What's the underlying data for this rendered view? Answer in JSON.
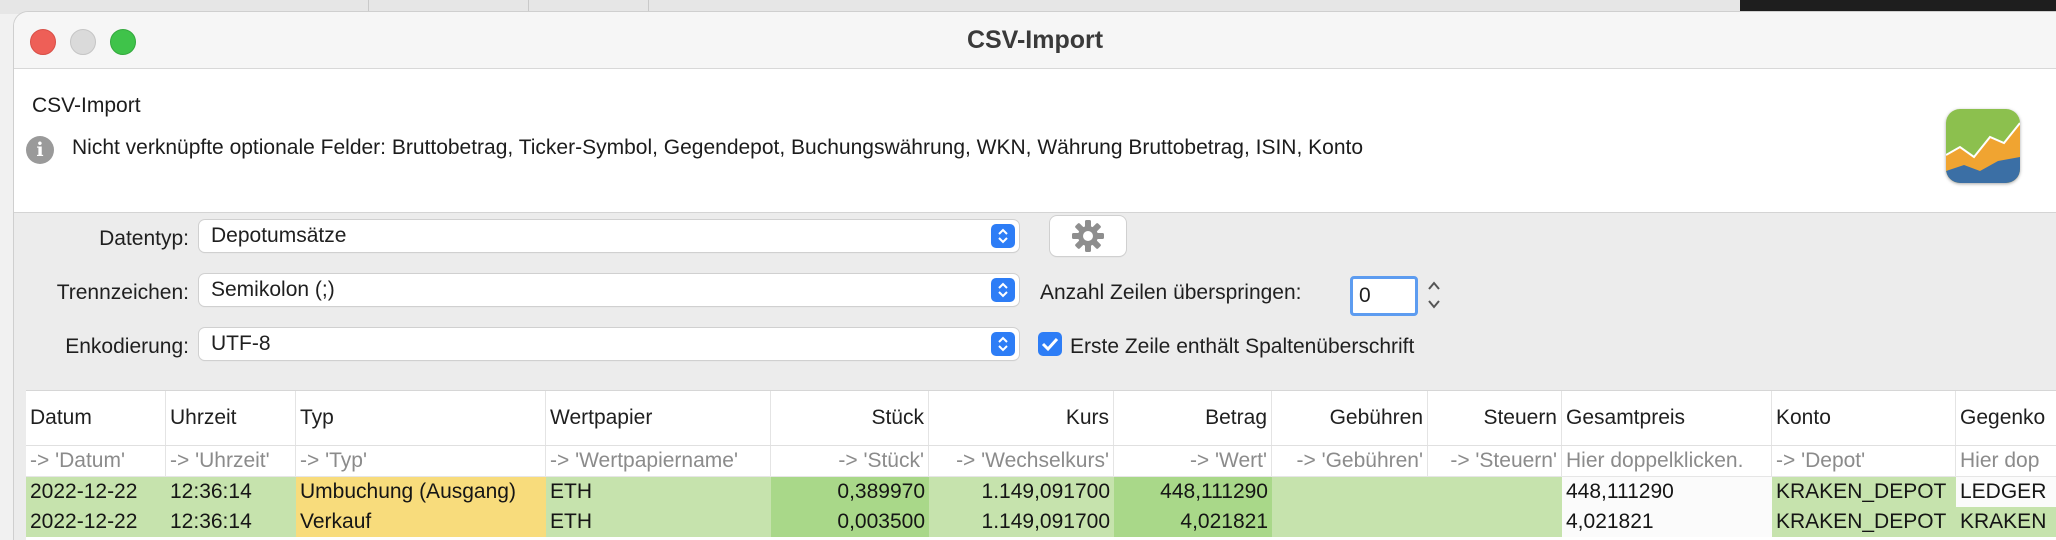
{
  "window": {
    "title": "CSV-Import"
  },
  "header": {
    "title": "CSV-Import",
    "info_text": "Nicht verknüpfte optionale Felder: Bruttobetrag, Ticker-Symbol, Gegendepot, Buchungswährung, WKN, Währung Bruttobetrag, ISIN, Konto"
  },
  "form": {
    "datatype_label": "Datentyp:",
    "datatype_value": "Depotumsätze",
    "separator_label": "Trennzeichen:",
    "separator_value": "Semikolon (;)",
    "encoding_label": "Enkodierung:",
    "encoding_value": "UTF-8",
    "skip_label": "Anzahl Zeilen überspringen:",
    "skip_value": "0",
    "header_checkbox_label": "Erste Zeile enthält Spaltenüberschrift",
    "header_checkbox_checked": true
  },
  "table": {
    "columns": [
      "Datum",
      "Uhrzeit",
      "Typ",
      "Wertpapier",
      "Stück",
      "Kurs",
      "Betrag",
      "Gebühren",
      "Steuern",
      "Gesamtpreis",
      "Konto",
      "Gegenko"
    ],
    "mappings": [
      "-> 'Datum'",
      "-> 'Uhrzeit'",
      "-> 'Typ'",
      "-> 'Wertpapiername'",
      "-> 'Stück'",
      "-> 'Wechselkurs'",
      "-> 'Wert'",
      "-> 'Gebühren'",
      "-> 'Steuern'",
      "Hier doppelklicken.",
      "-> 'Depot'",
      "Hier dop"
    ],
    "rows": [
      [
        "2022-12-22",
        "12:36:14",
        "Umbuchung (Ausgang)",
        "ETH",
        "0,389970",
        "1.149,091700",
        "448,111290",
        "",
        "",
        "448,111290",
        "KRAKEN_DEPOT",
        "LEDGER"
      ],
      [
        "2022-12-22",
        "12:36:14",
        "Verkauf",
        "ETH",
        "0,003500",
        "1.149,091700",
        "4,021821",
        "",
        "",
        "4,021821",
        "KRAKEN_DEPOT",
        "KRAKEN"
      ]
    ]
  },
  "colors": {
    "accent": "#2d7df6",
    "mapped_cell": "#c6e3ad",
    "type_cell": "#f8dc7c"
  },
  "icons": [
    "info-icon",
    "gear-icon",
    "app-logo-icon",
    "chevron-updown-icon",
    "checkmark-icon"
  ]
}
